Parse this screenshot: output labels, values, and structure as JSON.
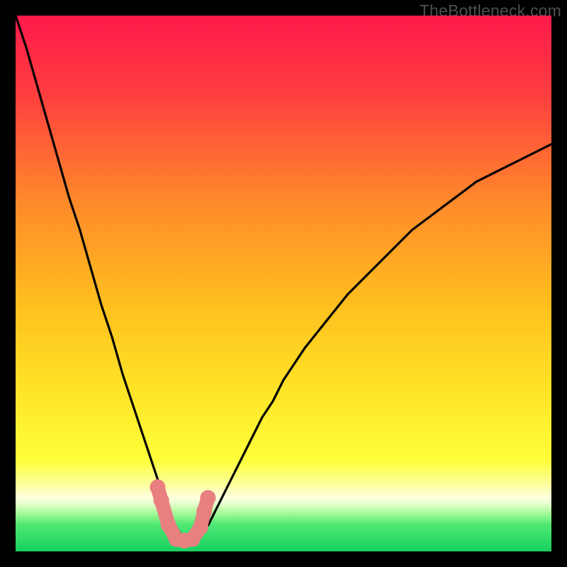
{
  "attribution": "TheBottleneck.com",
  "colors": {
    "bg": "#000000",
    "grad_top": "#ff1a4b",
    "grad_mid1": "#ff6a2a",
    "grad_mid2": "#ffd21f",
    "grad_yellow": "#ffff3a",
    "grad_pale": "#feffc4",
    "grad_green": "#1fe06a",
    "curve": "#000000",
    "marker_fill": "#e88080",
    "marker_stroke": "#c85a5a"
  },
  "chart_data": {
    "type": "line",
    "title": "",
    "xlabel": "",
    "ylabel": "",
    "xlim": [
      0,
      100
    ],
    "ylim": [
      0,
      100
    ],
    "x": [
      0,
      2,
      4,
      6,
      8,
      10,
      12,
      14,
      16,
      18,
      20,
      22,
      24,
      26,
      27,
      28,
      29,
      30,
      31,
      32,
      33,
      34,
      35,
      36,
      38,
      40,
      42,
      44,
      46,
      48,
      50,
      54,
      58,
      62,
      66,
      70,
      74,
      78,
      82,
      86,
      90,
      94,
      98,
      100
    ],
    "y": [
      100,
      94,
      87,
      80,
      73,
      66,
      60,
      53,
      46,
      40,
      33,
      27,
      21,
      15,
      12,
      9,
      6.5,
      4.5,
      3,
      2,
      2,
      2.5,
      3.5,
      5,
      9,
      13,
      17,
      21,
      25,
      28,
      32,
      38,
      43,
      48,
      52,
      56,
      60,
      63,
      66,
      69,
      71,
      73,
      75,
      76
    ],
    "markers": {
      "x": [
        26.5,
        27.2,
        28.5,
        30,
        31.5,
        33,
        34.5,
        35.2,
        35.9
      ],
      "y": [
        12,
        9.5,
        5,
        2.3,
        2,
        2.3,
        4.5,
        7.5,
        10
      ]
    }
  }
}
